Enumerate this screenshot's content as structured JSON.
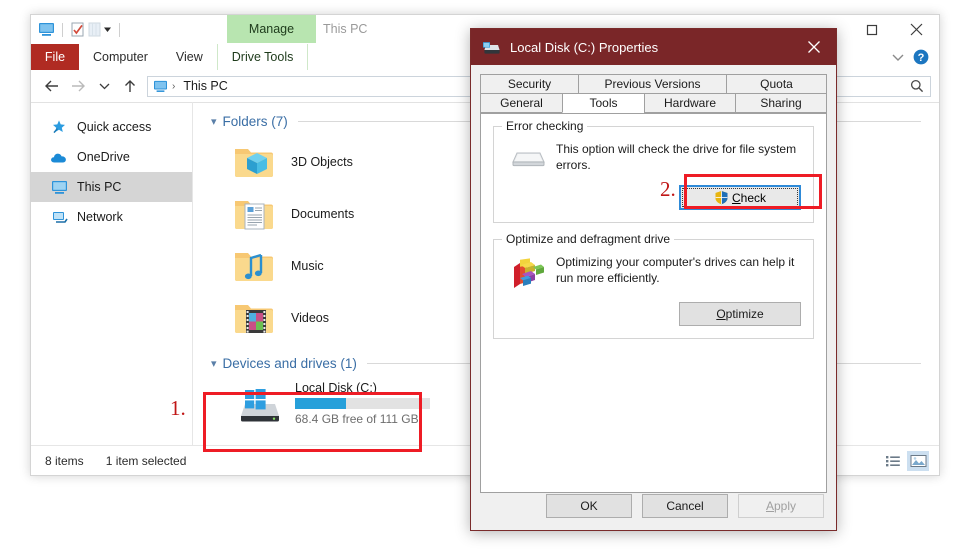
{
  "explorer": {
    "window_title": "This PC",
    "quick_access_toolbar": {
      "monitor_icon": "this-pc-icon",
      "properties_icon": "properties-icon",
      "customize_icon": "customize-qat-dropdown-icon"
    },
    "contextual_tab_header": "Manage",
    "ribbon_tabs": [
      {
        "label": "File",
        "kind": "file"
      },
      {
        "label": "Computer",
        "kind": "normal"
      },
      {
        "label": "View",
        "kind": "normal"
      },
      {
        "label": "Drive Tools",
        "kind": "contextual"
      }
    ],
    "window_buttons": {
      "maximize": "maximize-icon",
      "close": "close-icon",
      "collapse_ribbon": "chevron-down-icon",
      "help": "help-icon"
    },
    "address_bar": {
      "back": "back-arrow-icon",
      "forward": "forward-arrow-icon",
      "recent": "recent-locations-chevron-icon",
      "up": "up-arrow-icon",
      "path_icon": "this-pc-icon",
      "path_separator": "›",
      "path_text": "This PC",
      "search_placeholder": "",
      "search_icon": "search-icon"
    },
    "sidebar": [
      {
        "label": "Quick access",
        "icon": "star-pin-icon",
        "selected": false
      },
      {
        "label": "OneDrive",
        "icon": "cloud-icon",
        "selected": false
      },
      {
        "label": "This PC",
        "icon": "monitor-icon",
        "selected": true
      },
      {
        "label": "Network",
        "icon": "network-icon",
        "selected": false
      }
    ],
    "groups": [
      {
        "title": "Folders (7)",
        "items": [
          {
            "label": "3D Objects",
            "icon": "folder-3d-objects-icon"
          },
          {
            "label": "Documents",
            "icon": "folder-documents-icon"
          },
          {
            "label": "Music",
            "icon": "folder-music-icon"
          },
          {
            "label": "Videos",
            "icon": "folder-videos-icon"
          }
        ]
      },
      {
        "title": "Devices and drives (1)",
        "drives": [
          {
            "name": "Local Disk (C:)",
            "free_text": "68.4 GB free of 111 GB",
            "used_percent": 38,
            "bar_color": "#26a0da",
            "icon": "hard-drive-windows-icon"
          }
        ]
      }
    ],
    "status_bar": {
      "item_count": "8 items",
      "selection": "1 item selected",
      "view_details_icon": "details-view-icon",
      "view_large_icons_icon": "large-icons-view-icon"
    }
  },
  "annotations": [
    {
      "number": "1.",
      "target": "local-disk-drive-item"
    },
    {
      "number": "2.",
      "target": "check-button"
    }
  ],
  "dialog": {
    "title": "Local Disk (C:) Properties",
    "title_icon": "hard-drive-icon",
    "close_icon": "close-icon",
    "tabs_row1": [
      {
        "label": "Security",
        "active": false
      },
      {
        "label": "Previous Versions",
        "active": false
      },
      {
        "label": "Quota",
        "active": false
      }
    ],
    "tabs_row2": [
      {
        "label": "General",
        "active": false
      },
      {
        "label": "Tools",
        "active": true
      },
      {
        "label": "Hardware",
        "active": false
      },
      {
        "label": "Sharing",
        "active": false
      }
    ],
    "error_checking": {
      "group_title": "Error checking",
      "icon": "drive-scan-icon",
      "description": "This option will check the drive for file system errors.",
      "button_label": "Check",
      "button_icon": "uac-shield-icon"
    },
    "optimize": {
      "group_title": "Optimize and defragment drive",
      "icon": "defragment-icon",
      "description": "Optimizing your computer's drives can help it run more efficiently.",
      "button_label": "Optimize"
    },
    "footer_buttons": [
      {
        "label": "OK",
        "disabled": false
      },
      {
        "label": "Cancel",
        "disabled": false
      },
      {
        "label": "Apply",
        "disabled": true
      }
    ]
  },
  "colors": {
    "dialog_title_bar": "#7a2628",
    "file_tab": "#b02b22",
    "contextual_tab": "#b8e5b0",
    "drive_bar": "#26a0da",
    "annotation_red": "#ee1c25",
    "group_header_text": "#3a6ea5"
  }
}
